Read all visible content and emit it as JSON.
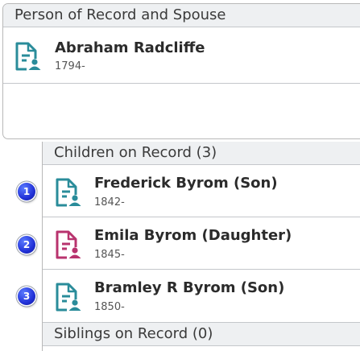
{
  "person_section": {
    "title": "Person of Record and Spouse",
    "person": {
      "name": "Abraham Radcliffe",
      "years": "1794-",
      "icon": "male-record-icon"
    }
  },
  "children_section": {
    "title": "Children on Record (3)",
    "children": [
      {
        "number": "1",
        "name": "Frederick Byrom (Son)",
        "years": "1842-",
        "icon": "male-record-icon"
      },
      {
        "number": "2",
        "name": "Emila Byrom (Daughter)",
        "years": "1845-",
        "icon": "female-record-icon"
      },
      {
        "number": "3",
        "name": "Bramley R Byrom (Son)",
        "years": "1850-",
        "icon": "male-record-icon"
      }
    ]
  },
  "siblings_section": {
    "title": "Siblings on Record (0)"
  },
  "colors": {
    "male": "#2a8c9a",
    "female": "#b8336e",
    "badge": "#2232d8",
    "header_bg": "#eef0f2",
    "border": "#c4c7cb"
  }
}
